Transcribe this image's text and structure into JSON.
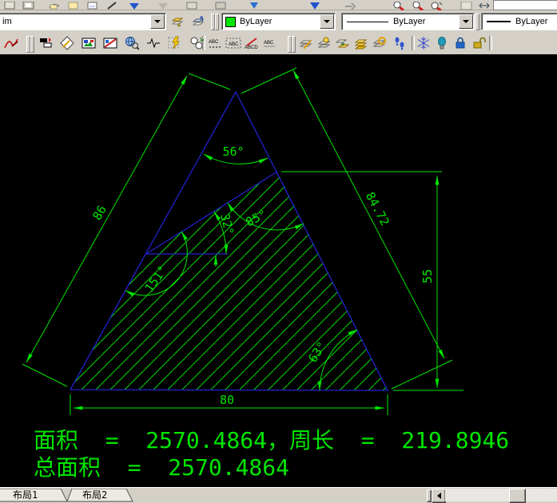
{
  "properties_toolbar": {
    "layer_value": "im",
    "color_value": "ByLayer",
    "linetype_value": "ByLayer",
    "lineweight_value": "ByLayer"
  },
  "toolbar_text_icons": {
    "abc_dots": "ABC",
    "abc_frame": "ABC",
    "abcd": "ABCD",
    "abc_plain": "ABC"
  },
  "drawing": {
    "dimensions": {
      "left_side": "86",
      "right_side": "84.72",
      "height_right": "55",
      "bottom": "80"
    },
    "angles": {
      "apex": "56°",
      "small": "32°",
      "at_e": "85°",
      "at_d": "151°",
      "corner": "63°"
    },
    "results": {
      "line1": "面积  =  2570.4864，周长  =  219.8946",
      "line2": "总面积  =  2570.4864"
    },
    "colors": {
      "geometry": "#2222cc",
      "annotation": "#00e600",
      "hatch": "#00dd00",
      "background": "#000000"
    }
  },
  "status_bar": {
    "layout_tab_1": "布局1",
    "layout_tab_2": "布局2"
  }
}
